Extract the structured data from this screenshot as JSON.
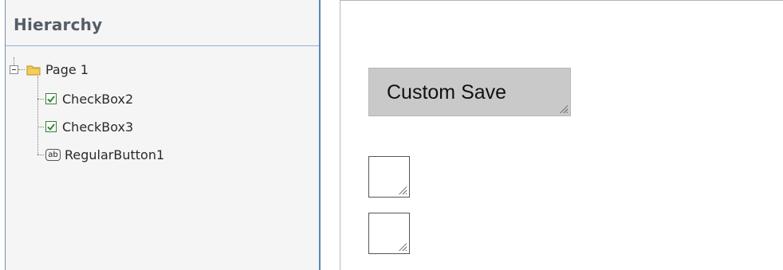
{
  "hierarchy": {
    "title": "Hierarchy",
    "root": {
      "label": "Page 1",
      "icon": "folder-icon"
    },
    "children": [
      {
        "label": "CheckBox2",
        "icon": "checkbox-checked-icon"
      },
      {
        "label": "CheckBox3",
        "icon": "checkbox-checked-icon"
      },
      {
        "label": "RegularButton1",
        "icon": "button-ab-icon",
        "icon_text": "ab"
      }
    ]
  },
  "canvas": {
    "button_label": "Custom Save"
  },
  "colors": {
    "panel_bg": "#f5f5f5",
    "panel_border": "#5b86b5",
    "header_text": "#555d66",
    "check_green": "#2e8b2e",
    "folder_yellow": "#f3cf5a",
    "button_bg": "#c9c9c9"
  }
}
